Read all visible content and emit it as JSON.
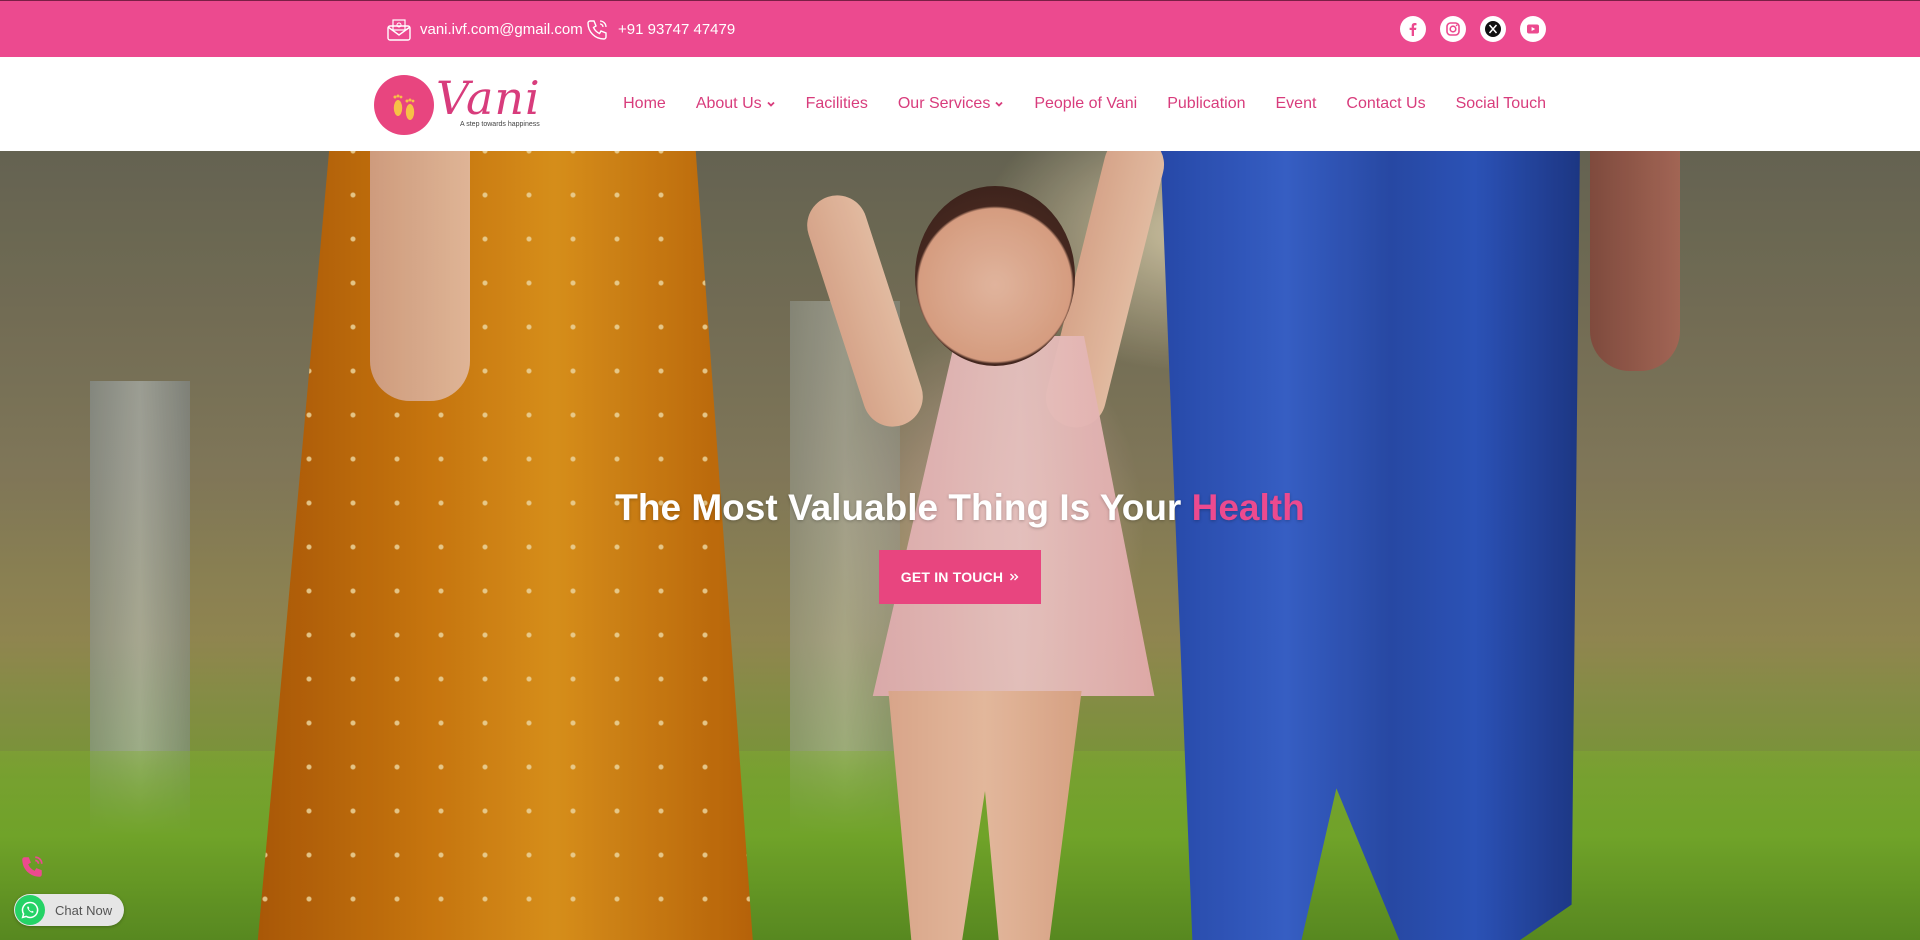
{
  "topbar": {
    "email": "vani.ivf.com@gmail.com",
    "phone": "+91 93747 47479",
    "socials": [
      {
        "name": "facebook",
        "icon": "facebook-icon"
      },
      {
        "name": "instagram",
        "icon": "instagram-icon"
      },
      {
        "name": "x",
        "icon": "x-icon"
      },
      {
        "name": "youtube",
        "icon": "youtube-icon"
      }
    ],
    "bg_color": "#ec4a8f"
  },
  "logo": {
    "name": "Vani",
    "tagline": "A step towards happiness",
    "icon": "footprints-icon"
  },
  "nav": {
    "items": [
      {
        "label": "Home",
        "dropdown": false
      },
      {
        "label": "About Us",
        "dropdown": true
      },
      {
        "label": "Facilities",
        "dropdown": false
      },
      {
        "label": "Our Services",
        "dropdown": true
      },
      {
        "label": "People of Vani",
        "dropdown": false
      },
      {
        "label": "Publication",
        "dropdown": false
      },
      {
        "label": "Event",
        "dropdown": false
      },
      {
        "label": "Contact Us",
        "dropdown": false
      },
      {
        "label": "Social Touch",
        "dropdown": false
      }
    ],
    "link_color": "#d83c7c"
  },
  "hero": {
    "title_main": "The Most Valuable Thing Is Your ",
    "title_accent": "Health",
    "cta_label": "GET IN TOUCH",
    "cta_icon": "double-chevron-right-icon",
    "accent_color": "#ec4a8f"
  },
  "floating": {
    "call_icon": "phone-icon",
    "chat_label": "Chat Now",
    "chat_icon": "whatsapp-icon"
  }
}
